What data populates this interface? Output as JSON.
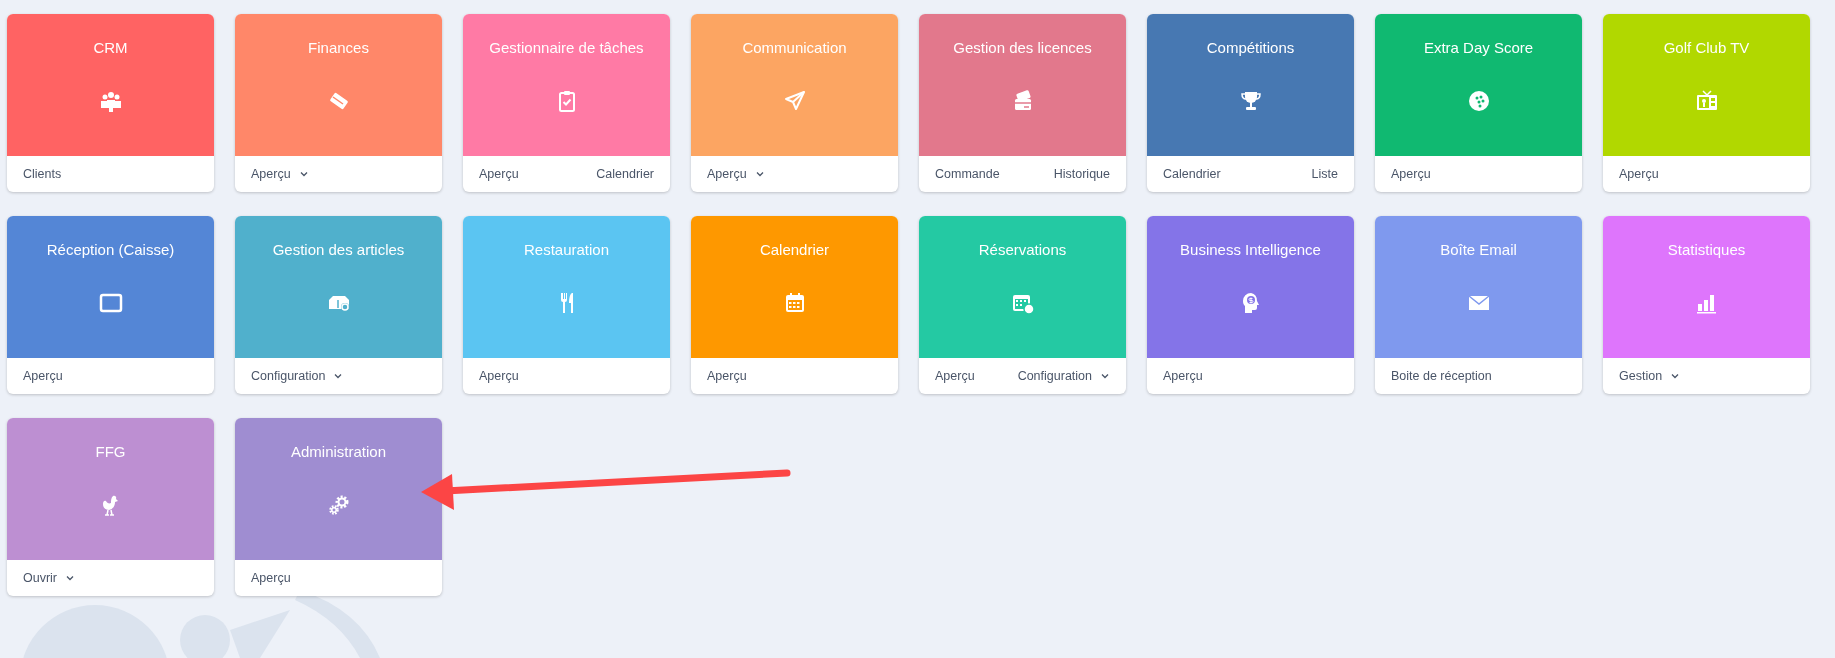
{
  "tiles": [
    {
      "title": "CRM",
      "color": "#ff6363",
      "links": [
        {
          "label": "Clients",
          "dropdown": false
        }
      ]
    },
    {
      "title": "Finances",
      "color": "#ff8769",
      "links": [
        {
          "label": "Aperçu",
          "dropdown": true
        }
      ]
    },
    {
      "title": "Gestionnaire de tâches",
      "color": "#ff7aa5",
      "links": [
        {
          "label": "Aperçu",
          "dropdown": false
        },
        {
          "label": "Calendrier",
          "dropdown": false
        }
      ]
    },
    {
      "title": "Communication",
      "color": "#fca562",
      "links": [
        {
          "label": "Aperçu",
          "dropdown": true
        }
      ]
    },
    {
      "title": "Gestion des licences",
      "color": "#e2788c",
      "links": [
        {
          "label": "Commande",
          "dropdown": false
        },
        {
          "label": "Historique",
          "dropdown": false
        }
      ]
    },
    {
      "title": "Compétitions",
      "color": "#4778b2",
      "links": [
        {
          "label": "Calendrier",
          "dropdown": false
        },
        {
          "label": "Liste",
          "dropdown": false
        }
      ]
    },
    {
      "title": "Extra Day Score",
      "color": "#10b971",
      "links": [
        {
          "label": "Aperçu",
          "dropdown": false
        }
      ]
    },
    {
      "title": "Golf Club TV",
      "color": "#b1d800",
      "links": [
        {
          "label": "Aperçu",
          "dropdown": false
        }
      ]
    },
    {
      "title": "Réception (Caisse)",
      "color": "#5486d6",
      "links": [
        {
          "label": "Aperçu",
          "dropdown": false
        }
      ]
    },
    {
      "title": "Gestion des articles",
      "color": "#50b0cc",
      "links": [
        {
          "label": "Configuration",
          "dropdown": true
        }
      ]
    },
    {
      "title": "Restauration",
      "color": "#5bc5f2",
      "links": [
        {
          "label": "Aperçu",
          "dropdown": false
        }
      ]
    },
    {
      "title": "Calendrier",
      "color": "#fe9800",
      "links": [
        {
          "label": "Aperçu",
          "dropdown": false
        }
      ]
    },
    {
      "title": "Réservations",
      "color": "#24c9a3",
      "links": [
        {
          "label": "Aperçu",
          "dropdown": false
        },
        {
          "label": "Configuration",
          "dropdown": true
        }
      ]
    },
    {
      "title": "Business Intelligence",
      "color": "#8474e8",
      "links": [
        {
          "label": "Aperçu",
          "dropdown": false
        }
      ]
    },
    {
      "title": "Boîte Email",
      "color": "#7f99ee",
      "links": [
        {
          "label": "Boite de réception",
          "dropdown": false
        }
      ]
    },
    {
      "title": "Statistiques",
      "color": "#de75fc",
      "links": [
        {
          "label": "Gestion",
          "dropdown": true
        }
      ]
    },
    {
      "title": "FFG",
      "color": "#bd8fd2",
      "links": [
        {
          "label": "Ouvrir",
          "dropdown": true
        }
      ]
    },
    {
      "title": "Administration",
      "color": "#9f8dd1",
      "links": [
        {
          "label": "Aperçu",
          "dropdown": false
        }
      ]
    }
  ],
  "annotation": {
    "kind": "arrow",
    "color": "#fc4545"
  }
}
